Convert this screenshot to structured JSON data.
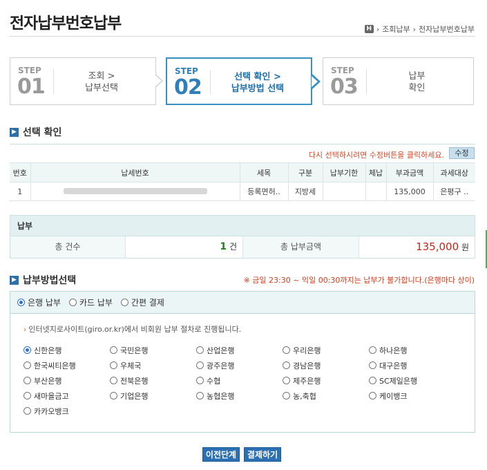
{
  "page_title": "전자납부번호납부",
  "breadcrumb": {
    "home": "H",
    "items": [
      "조회납부",
      "전자납부번호납부"
    ]
  },
  "steps": [
    {
      "label": "STEP",
      "num": "01",
      "line1": "조회 >",
      "line2": "납부선택"
    },
    {
      "label": "STEP",
      "num": "02",
      "line1": "선택 확인 >",
      "line2": "납부방법 선택"
    },
    {
      "label": "STEP",
      "num": "03",
      "line1": "납부",
      "line2": "확인"
    }
  ],
  "selection": {
    "title": "선택 확인",
    "notice": "다시 선택하시려면 수정버튼을 클릭하세요.",
    "edit_button": "수정",
    "columns": [
      "번호",
      "납세번호",
      "세목",
      "구분",
      "납부기한",
      "체납",
      "부과금액",
      "과세대상"
    ],
    "rows": [
      {
        "no": "1",
        "tax_no": "",
        "item": "등록면허..",
        "type": "지방세",
        "due": "",
        "arrears": "",
        "amount": "135,000",
        "target": "은평구 .."
      }
    ]
  },
  "payment": {
    "title": "납부",
    "count_label": "총 건수",
    "count_value": "1",
    "count_unit": "건",
    "amount_label": "총 납부금액",
    "amount_value": "135,000",
    "amount_unit": "원"
  },
  "method": {
    "title": "납부방법선택",
    "warning": "※ 금일 23:30 ~ 익일 00:30까지는 납부가 불가합니다.(은행마다 상이)",
    "tabs": [
      "은행 납부",
      "카드 납부",
      "간편 결제"
    ],
    "selected_tab": 0,
    "description": "인터넷지로사이트(giro.or.kr)에서 비회원 납부 절차로 진행됩니다.",
    "banks": [
      "신한은행",
      "국민은행",
      "산업은행",
      "우리은행",
      "하나은행",
      "한국씨티은행",
      "우체국",
      "광주은행",
      "경남은행",
      "대구은행",
      "부산은행",
      "전북은행",
      "수협",
      "제주은행",
      "SC제일은행",
      "새마을금고",
      "기업은행",
      "농협은행",
      "농,축협",
      "케이뱅크",
      "카카오뱅크"
    ],
    "selected_bank": 0
  },
  "buttons": {
    "prev": "이전단계",
    "pay": "결제하기"
  },
  "colors": {
    "accent": "#2a70b3",
    "notice": "#d24a2e",
    "amount": "#c0271a",
    "count": "#2b7a2b"
  }
}
